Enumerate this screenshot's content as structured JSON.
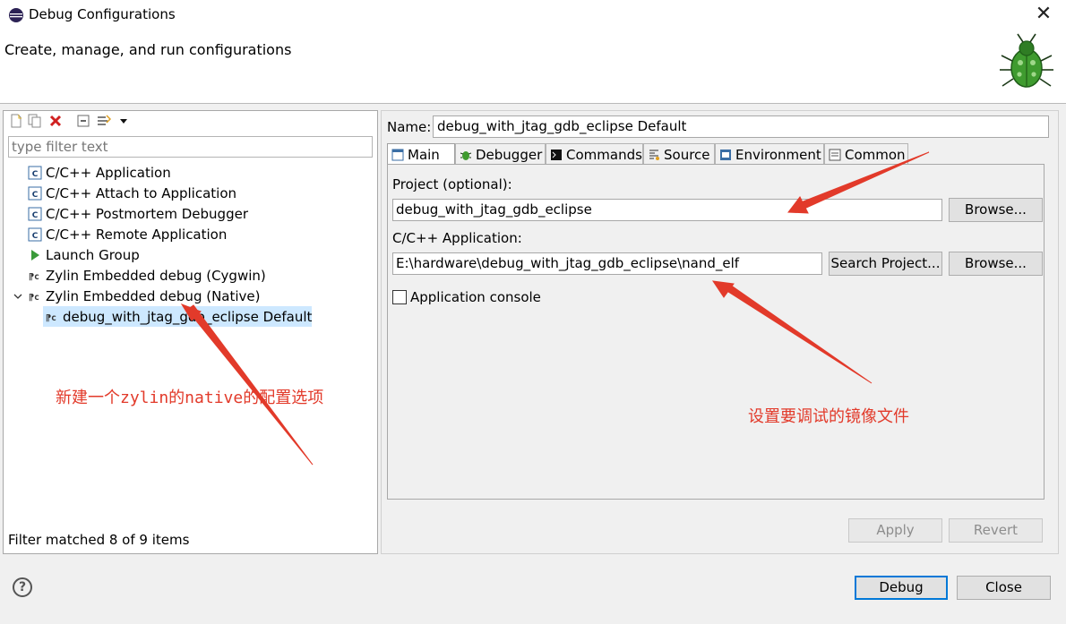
{
  "window": {
    "title": "Debug Configurations",
    "close_glyph": "✕"
  },
  "header": {
    "subtitle": "Create, manage, and run configurations"
  },
  "left": {
    "filter_placeholder": "type filter text",
    "tree": [
      {
        "label": "C/C++ Application",
        "icon": "c-app-icon"
      },
      {
        "label": "C/C++ Attach to Application",
        "icon": "c-app-icon"
      },
      {
        "label": "C/C++ Postmortem Debugger",
        "icon": "c-app-icon"
      },
      {
        "label": "C/C++ Remote Application",
        "icon": "c-app-icon"
      },
      {
        "label": "Launch Group",
        "icon": "launch-group-icon"
      },
      {
        "label": "Zylin Embedded debug (Cygwin)",
        "icon": "zylin-icon"
      },
      {
        "label": "Zylin Embedded debug (Native)",
        "icon": "zylin-icon",
        "expanded": true
      },
      {
        "label": "debug_with_jtag_gdb_eclipse Default",
        "icon": "zylin-icon",
        "selected": true
      }
    ],
    "status": "Filter matched 8 of 9 items"
  },
  "right": {
    "name_label": "Name:",
    "name_value": "debug_with_jtag_gdb_eclipse Default",
    "tabs": [
      {
        "label": "Main",
        "icon": "main-tab-icon",
        "active": true
      },
      {
        "label": "Debugger",
        "icon": "debugger-tab-icon"
      },
      {
        "label": "Commands",
        "icon": "commands-tab-icon"
      },
      {
        "label": "Source",
        "icon": "source-tab-icon"
      },
      {
        "label": "Environment",
        "icon": "environment-tab-icon"
      },
      {
        "label": "Common",
        "icon": "common-tab-icon"
      }
    ],
    "project_label": "Project (optional):",
    "project_value": "debug_with_jtag_gdb_eclipse",
    "browse_label": "Browse...",
    "app_label": "C/C++ Application:",
    "app_value": "E:\\hardware\\debug_with_jtag_gdb_eclipse\\nand_elf",
    "search_project_label": "Search Project...",
    "console_label": "Application console",
    "console_checked": false,
    "apply_label": "Apply",
    "revert_label": "Revert"
  },
  "footer": {
    "help_glyph": "?",
    "debug_label": "Debug",
    "close_label": "Close"
  },
  "annotations": {
    "left_note": "新建一个zylin的native的配置选项",
    "right_note": "设置要调试的镜像文件",
    "color": "#e23a2a"
  }
}
